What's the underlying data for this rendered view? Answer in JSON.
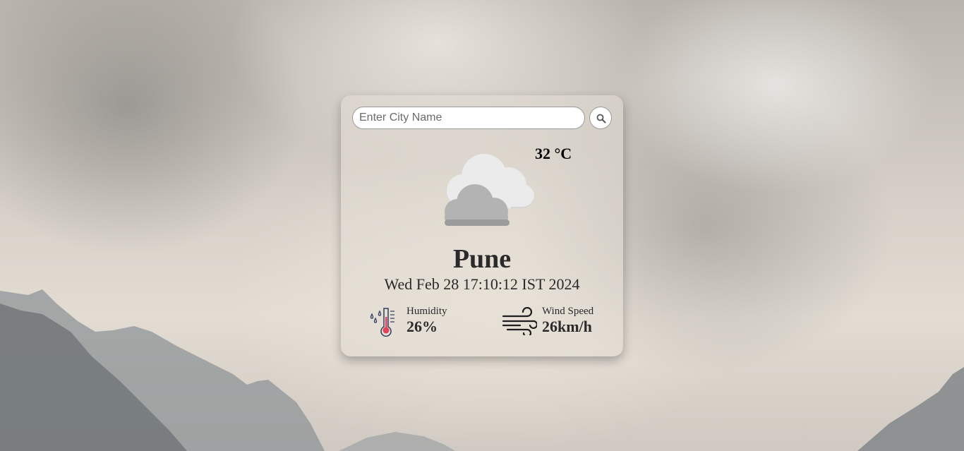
{
  "search": {
    "placeholder": "Enter City Name",
    "value": "",
    "button_icon": "search-icon"
  },
  "weather": {
    "condition_icon": "cloudy-icon",
    "temperature": "32 °C",
    "city": "Pune",
    "datetime": "Wed Feb 28 17:10:12 IST 2024"
  },
  "details": {
    "humidity": {
      "icon": "humidity-thermometer-icon",
      "label": "Humidity",
      "value": "26%"
    },
    "wind": {
      "icon": "wind-icon",
      "label": "Wind Speed",
      "value": "26km/h"
    }
  },
  "colors": {
    "card_background": "#e1dcd4",
    "text": "#2a2a2a",
    "thermometer_red": "#e0445a",
    "icon_stroke": "#2f3e5e"
  }
}
